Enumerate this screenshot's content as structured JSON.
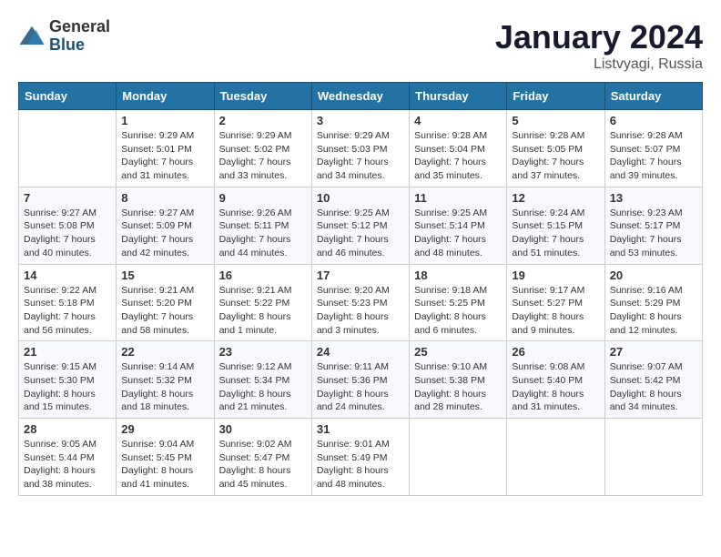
{
  "header": {
    "logo_general": "General",
    "logo_blue": "Blue",
    "month_title": "January 2024",
    "location": "Listvyagi, Russia"
  },
  "days": [
    "Sunday",
    "Monday",
    "Tuesday",
    "Wednesday",
    "Thursday",
    "Friday",
    "Saturday"
  ],
  "weeks": [
    [
      {
        "day": "",
        "sunrise": "",
        "sunset": "",
        "daylight": ""
      },
      {
        "day": "1",
        "sunrise": "Sunrise: 9:29 AM",
        "sunset": "Sunset: 5:01 PM",
        "daylight": "Daylight: 7 hours and 31 minutes."
      },
      {
        "day": "2",
        "sunrise": "Sunrise: 9:29 AM",
        "sunset": "Sunset: 5:02 PM",
        "daylight": "Daylight: 7 hours and 33 minutes."
      },
      {
        "day": "3",
        "sunrise": "Sunrise: 9:29 AM",
        "sunset": "Sunset: 5:03 PM",
        "daylight": "Daylight: 7 hours and 34 minutes."
      },
      {
        "day": "4",
        "sunrise": "Sunrise: 9:28 AM",
        "sunset": "Sunset: 5:04 PM",
        "daylight": "Daylight: 7 hours and 35 minutes."
      },
      {
        "day": "5",
        "sunrise": "Sunrise: 9:28 AM",
        "sunset": "Sunset: 5:05 PM",
        "daylight": "Daylight: 7 hours and 37 minutes."
      },
      {
        "day": "6",
        "sunrise": "Sunrise: 9:28 AM",
        "sunset": "Sunset: 5:07 PM",
        "daylight": "Daylight: 7 hours and 39 minutes."
      }
    ],
    [
      {
        "day": "7",
        "sunrise": "Sunrise: 9:27 AM",
        "sunset": "Sunset: 5:08 PM",
        "daylight": "Daylight: 7 hours and 40 minutes."
      },
      {
        "day": "8",
        "sunrise": "Sunrise: 9:27 AM",
        "sunset": "Sunset: 5:09 PM",
        "daylight": "Daylight: 7 hours and 42 minutes."
      },
      {
        "day": "9",
        "sunrise": "Sunrise: 9:26 AM",
        "sunset": "Sunset: 5:11 PM",
        "daylight": "Daylight: 7 hours and 44 minutes."
      },
      {
        "day": "10",
        "sunrise": "Sunrise: 9:25 AM",
        "sunset": "Sunset: 5:12 PM",
        "daylight": "Daylight: 7 hours and 46 minutes."
      },
      {
        "day": "11",
        "sunrise": "Sunrise: 9:25 AM",
        "sunset": "Sunset: 5:14 PM",
        "daylight": "Daylight: 7 hours and 48 minutes."
      },
      {
        "day": "12",
        "sunrise": "Sunrise: 9:24 AM",
        "sunset": "Sunset: 5:15 PM",
        "daylight": "Daylight: 7 hours and 51 minutes."
      },
      {
        "day": "13",
        "sunrise": "Sunrise: 9:23 AM",
        "sunset": "Sunset: 5:17 PM",
        "daylight": "Daylight: 7 hours and 53 minutes."
      }
    ],
    [
      {
        "day": "14",
        "sunrise": "Sunrise: 9:22 AM",
        "sunset": "Sunset: 5:18 PM",
        "daylight": "Daylight: 7 hours and 56 minutes."
      },
      {
        "day": "15",
        "sunrise": "Sunrise: 9:21 AM",
        "sunset": "Sunset: 5:20 PM",
        "daylight": "Daylight: 7 hours and 58 minutes."
      },
      {
        "day": "16",
        "sunrise": "Sunrise: 9:21 AM",
        "sunset": "Sunset: 5:22 PM",
        "daylight": "Daylight: 8 hours and 1 minute."
      },
      {
        "day": "17",
        "sunrise": "Sunrise: 9:20 AM",
        "sunset": "Sunset: 5:23 PM",
        "daylight": "Daylight: 8 hours and 3 minutes."
      },
      {
        "day": "18",
        "sunrise": "Sunrise: 9:18 AM",
        "sunset": "Sunset: 5:25 PM",
        "daylight": "Daylight: 8 hours and 6 minutes."
      },
      {
        "day": "19",
        "sunrise": "Sunrise: 9:17 AM",
        "sunset": "Sunset: 5:27 PM",
        "daylight": "Daylight: 8 hours and 9 minutes."
      },
      {
        "day": "20",
        "sunrise": "Sunrise: 9:16 AM",
        "sunset": "Sunset: 5:29 PM",
        "daylight": "Daylight: 8 hours and 12 minutes."
      }
    ],
    [
      {
        "day": "21",
        "sunrise": "Sunrise: 9:15 AM",
        "sunset": "Sunset: 5:30 PM",
        "daylight": "Daylight: 8 hours and 15 minutes."
      },
      {
        "day": "22",
        "sunrise": "Sunrise: 9:14 AM",
        "sunset": "Sunset: 5:32 PM",
        "daylight": "Daylight: 8 hours and 18 minutes."
      },
      {
        "day": "23",
        "sunrise": "Sunrise: 9:12 AM",
        "sunset": "Sunset: 5:34 PM",
        "daylight": "Daylight: 8 hours and 21 minutes."
      },
      {
        "day": "24",
        "sunrise": "Sunrise: 9:11 AM",
        "sunset": "Sunset: 5:36 PM",
        "daylight": "Daylight: 8 hours and 24 minutes."
      },
      {
        "day": "25",
        "sunrise": "Sunrise: 9:10 AM",
        "sunset": "Sunset: 5:38 PM",
        "daylight": "Daylight: 8 hours and 28 minutes."
      },
      {
        "day": "26",
        "sunrise": "Sunrise: 9:08 AM",
        "sunset": "Sunset: 5:40 PM",
        "daylight": "Daylight: 8 hours and 31 minutes."
      },
      {
        "day": "27",
        "sunrise": "Sunrise: 9:07 AM",
        "sunset": "Sunset: 5:42 PM",
        "daylight": "Daylight: 8 hours and 34 minutes."
      }
    ],
    [
      {
        "day": "28",
        "sunrise": "Sunrise: 9:05 AM",
        "sunset": "Sunset: 5:44 PM",
        "daylight": "Daylight: 8 hours and 38 minutes."
      },
      {
        "day": "29",
        "sunrise": "Sunrise: 9:04 AM",
        "sunset": "Sunset: 5:45 PM",
        "daylight": "Daylight: 8 hours and 41 minutes."
      },
      {
        "day": "30",
        "sunrise": "Sunrise: 9:02 AM",
        "sunset": "Sunset: 5:47 PM",
        "daylight": "Daylight: 8 hours and 45 minutes."
      },
      {
        "day": "31",
        "sunrise": "Sunrise: 9:01 AM",
        "sunset": "Sunset: 5:49 PM",
        "daylight": "Daylight: 8 hours and 48 minutes."
      },
      {
        "day": "",
        "sunrise": "",
        "sunset": "",
        "daylight": ""
      },
      {
        "day": "",
        "sunrise": "",
        "sunset": "",
        "daylight": ""
      },
      {
        "day": "",
        "sunrise": "",
        "sunset": "",
        "daylight": ""
      }
    ]
  ]
}
